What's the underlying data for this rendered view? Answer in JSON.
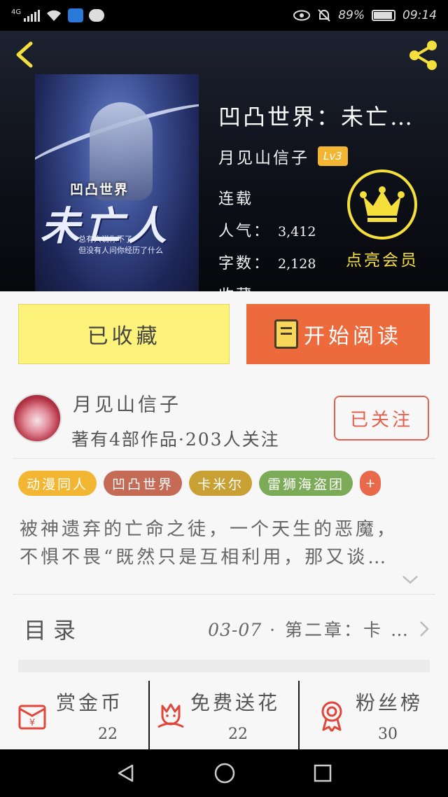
{
  "status_bar": {
    "network": "4G",
    "battery": "89%",
    "time": "09:14"
  },
  "book": {
    "title": "凹凸世界：未亡…",
    "author": "月见山信子",
    "level": "Lv3",
    "status": "连载",
    "popularity_label": "人气：",
    "popularity": "3,412",
    "words_label": "字数：",
    "words": "2,128",
    "collect_label_partial": "收藏",
    "cover": {
      "logo_text": "凹凸世界",
      "title_text": "未亡人",
      "tagline_1": "总有人说你不了",
      "tagline_2": "但没有人问你经历了什么"
    }
  },
  "vip": {
    "label": "点亮会员"
  },
  "actions": {
    "collected_label": "已收藏",
    "read_label": "开始阅读"
  },
  "author_card": {
    "name": "月见山信子",
    "info": "著有4部作品·203人关注",
    "follow_label": "已关注"
  },
  "tags": [
    {
      "label": "动漫同人",
      "color": "#f2b632"
    },
    {
      "label": "凹凸世界",
      "color": "#c46a55"
    },
    {
      "label": "卡米尔",
      "color": "#c9a033"
    },
    {
      "label": "雷狮海盗团",
      "color": "#7bab57"
    }
  ],
  "tags_more": "+",
  "description": {
    "line1": "被神遗弃的亡命之徒，一个天生的恶魔，",
    "line2": "不惧不畏“既然只是互相利用，那又谈…"
  },
  "catalog": {
    "title": "目录",
    "latest_date": "03-07",
    "latest_sep": " · ",
    "latest_chapter": "第二章：卡 …"
  },
  "stats": [
    {
      "label": "赏金币",
      "value": "22",
      "icon": "red-envelope-icon"
    },
    {
      "label": "免费送花",
      "value": "22",
      "icon": "flower-icon"
    },
    {
      "label": "粉丝榜",
      "value": "30",
      "icon": "medal-icon"
    }
  ],
  "colors": {
    "accent_orange": "#ec6a3c",
    "collected_yellow": "#fdf27a",
    "vip_gold": "#f5df3d",
    "follow_red": "#e65f4d"
  }
}
